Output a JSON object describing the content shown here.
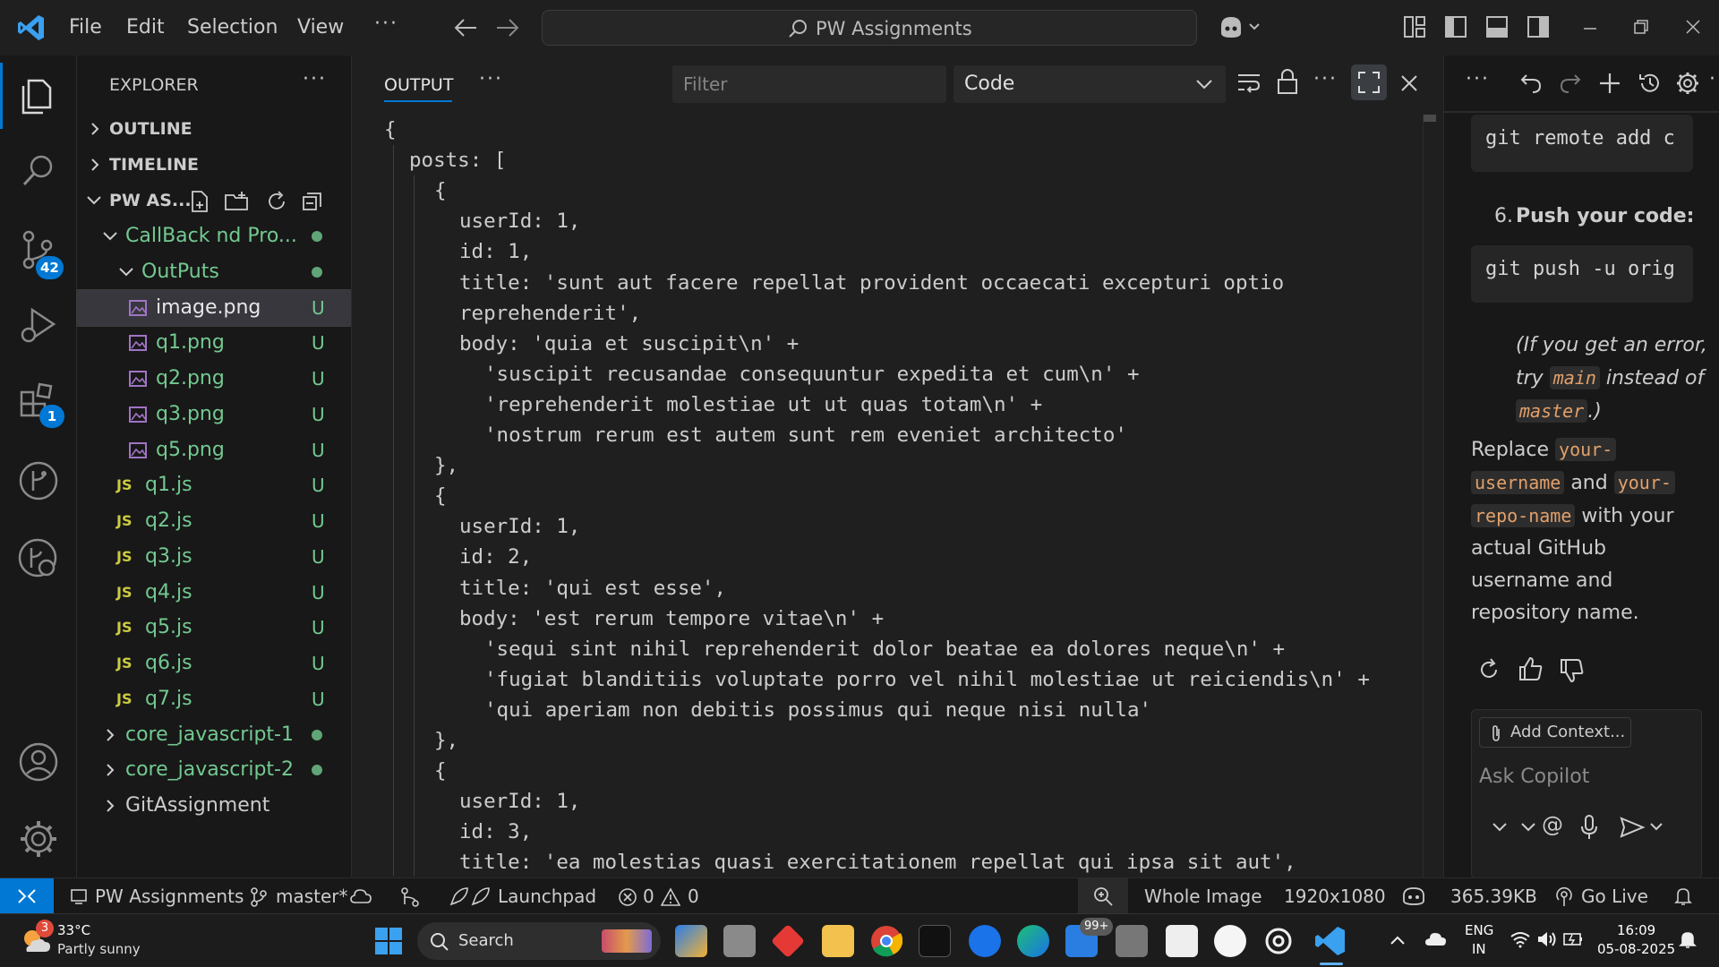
{
  "titlebar": {
    "menu": [
      "File",
      "Edit",
      "Selection",
      "View"
    ],
    "more": "···",
    "search_label": "PW Assignments"
  },
  "activity_badges": {
    "source_control": "42",
    "extensions": "1"
  },
  "explorer": {
    "title": "EXPLORER",
    "more": "···",
    "sections": {
      "outline": "OUTLINE",
      "timeline": "TIMELINE",
      "workspace": "PW AS..."
    },
    "tree": [
      {
        "label": "CallBack nd Pro...",
        "status": "dot",
        "kind": "folder-open",
        "depth": 1
      },
      {
        "label": "OutPuts",
        "status": "dot",
        "kind": "folder-open",
        "depth": 2
      },
      {
        "label": "image.png",
        "status": "U",
        "kind": "image",
        "depth": 3,
        "selected": true
      },
      {
        "label": "q1.png",
        "status": "U",
        "kind": "image",
        "depth": 3
      },
      {
        "label": "q2.png",
        "status": "U",
        "kind": "image",
        "depth": 3
      },
      {
        "label": "q3.png",
        "status": "U",
        "kind": "image",
        "depth": 3
      },
      {
        "label": "q5.png",
        "status": "U",
        "kind": "image",
        "depth": 3
      },
      {
        "label": "q1.js",
        "status": "U",
        "kind": "js",
        "depth": 2
      },
      {
        "label": "q2.js",
        "status": "U",
        "kind": "js",
        "depth": 2
      },
      {
        "label": "q3.js",
        "status": "U",
        "kind": "js",
        "depth": 2
      },
      {
        "label": "q4.js",
        "status": "U",
        "kind": "js",
        "depth": 2
      },
      {
        "label": "q5.js",
        "status": "U",
        "kind": "js",
        "depth": 2
      },
      {
        "label": "q6.js",
        "status": "U",
        "kind": "js",
        "depth": 2
      },
      {
        "label": "q7.js",
        "status": "U",
        "kind": "js",
        "depth": 2
      },
      {
        "label": "core_javascript-1",
        "status": "dot",
        "kind": "folder-closed",
        "depth": 1
      },
      {
        "label": "core_javascript-2",
        "status": "dot",
        "kind": "folder-closed",
        "depth": 1
      },
      {
        "label": "GitAssignment",
        "status": "",
        "kind": "folder-closed-plain",
        "depth": 1
      }
    ]
  },
  "output": {
    "tab_label": "OUTPUT",
    "more": "···",
    "filter_placeholder": "Filter",
    "channel": "Code",
    "lines": [
      {
        "indent": 0,
        "text": "{"
      },
      {
        "indent": 1,
        "text": "posts: ["
      },
      {
        "indent": 2,
        "text": "{"
      },
      {
        "indent": 3,
        "text": "userId: 1,"
      },
      {
        "indent": 3,
        "text": "id: 1,"
      },
      {
        "indent": 3,
        "text": "title: 'sunt aut facere repellat provident occaecati excepturi optio"
      },
      {
        "indent": 3,
        "text": "reprehenderit',"
      },
      {
        "indent": 3,
        "text": "body: 'quia et suscipit\\n' +"
      },
      {
        "indent": 4,
        "text": "'suscipit recusandae consequuntur expedita et cum\\n' +"
      },
      {
        "indent": 4,
        "text": "'reprehenderit molestiae ut ut quas totam\\n' +"
      },
      {
        "indent": 4,
        "text": "'nostrum rerum est autem sunt rem eveniet architecto'"
      },
      {
        "indent": 2,
        "text": "},"
      },
      {
        "indent": 2,
        "text": "{"
      },
      {
        "indent": 3,
        "text": "userId: 1,"
      },
      {
        "indent": 3,
        "text": "id: 2,"
      },
      {
        "indent": 3,
        "text": "title: 'qui est esse',"
      },
      {
        "indent": 3,
        "text": "body: 'est rerum tempore vitae\\n' +"
      },
      {
        "indent": 4,
        "text": "'sequi sint nihil reprehenderit dolor beatae ea dolores neque\\n' +"
      },
      {
        "indent": 4,
        "text": "'fugiat blanditiis voluptate porro vel nihil molestiae ut reiciendis\\n' +"
      },
      {
        "indent": 4,
        "text": "'qui aperiam non debitis possimus qui neque nisi nulla'"
      },
      {
        "indent": 2,
        "text": "},"
      },
      {
        "indent": 2,
        "text": "{"
      },
      {
        "indent": 3,
        "text": "userId: 1,"
      },
      {
        "indent": 3,
        "text": "id: 3,"
      },
      {
        "indent": 3,
        "text": "title: 'ea molestias quasi exercitationem repellat qui ipsa sit aut',"
      }
    ]
  },
  "chat": {
    "code1": "git remote add c",
    "step_number": "6.",
    "step_title": "Push your code:",
    "code2": "git push -u orig",
    "note_pre": "(If you get an error,",
    "note_try": "try",
    "note_main": "main",
    "note_instead": "instead of",
    "note_master": "master",
    "note_end": ".)",
    "replace": "Replace",
    "your_username_1": "your-",
    "your_username_2": "username",
    "and": "and",
    "your_repo_1": "your-",
    "your_repo_2": "repo-name",
    "with_your": "with your",
    "actual_github": "actual GitHub",
    "username_and": "username and",
    "repository_name": "repository name.",
    "add_context": "Add Context...",
    "ask_placeholder": "Ask Copilot",
    "at": "@"
  },
  "statusbar": {
    "workspace": "PW Assignments",
    "branch": "master*",
    "launchpad": "Launchpad",
    "errors": "0",
    "warnings": "0",
    "zoom_label": "Whole Image",
    "dimensions": "1920x1080",
    "filesize": "365.39KB",
    "golive": "Go Live"
  },
  "taskbar": {
    "temperature": "33°C",
    "weather": "Partly sunny",
    "weather_badge": "3",
    "search": "Search",
    "mail_badge": "99+",
    "lang1": "ENG",
    "lang2": "IN",
    "time": "16:09",
    "date": "05-08-2025"
  },
  "colors": {
    "accent": "#0078d4",
    "git_untracked": "#73c991",
    "js_yellow": "#cbcb41",
    "statusbar_remote": "#0078d4"
  }
}
